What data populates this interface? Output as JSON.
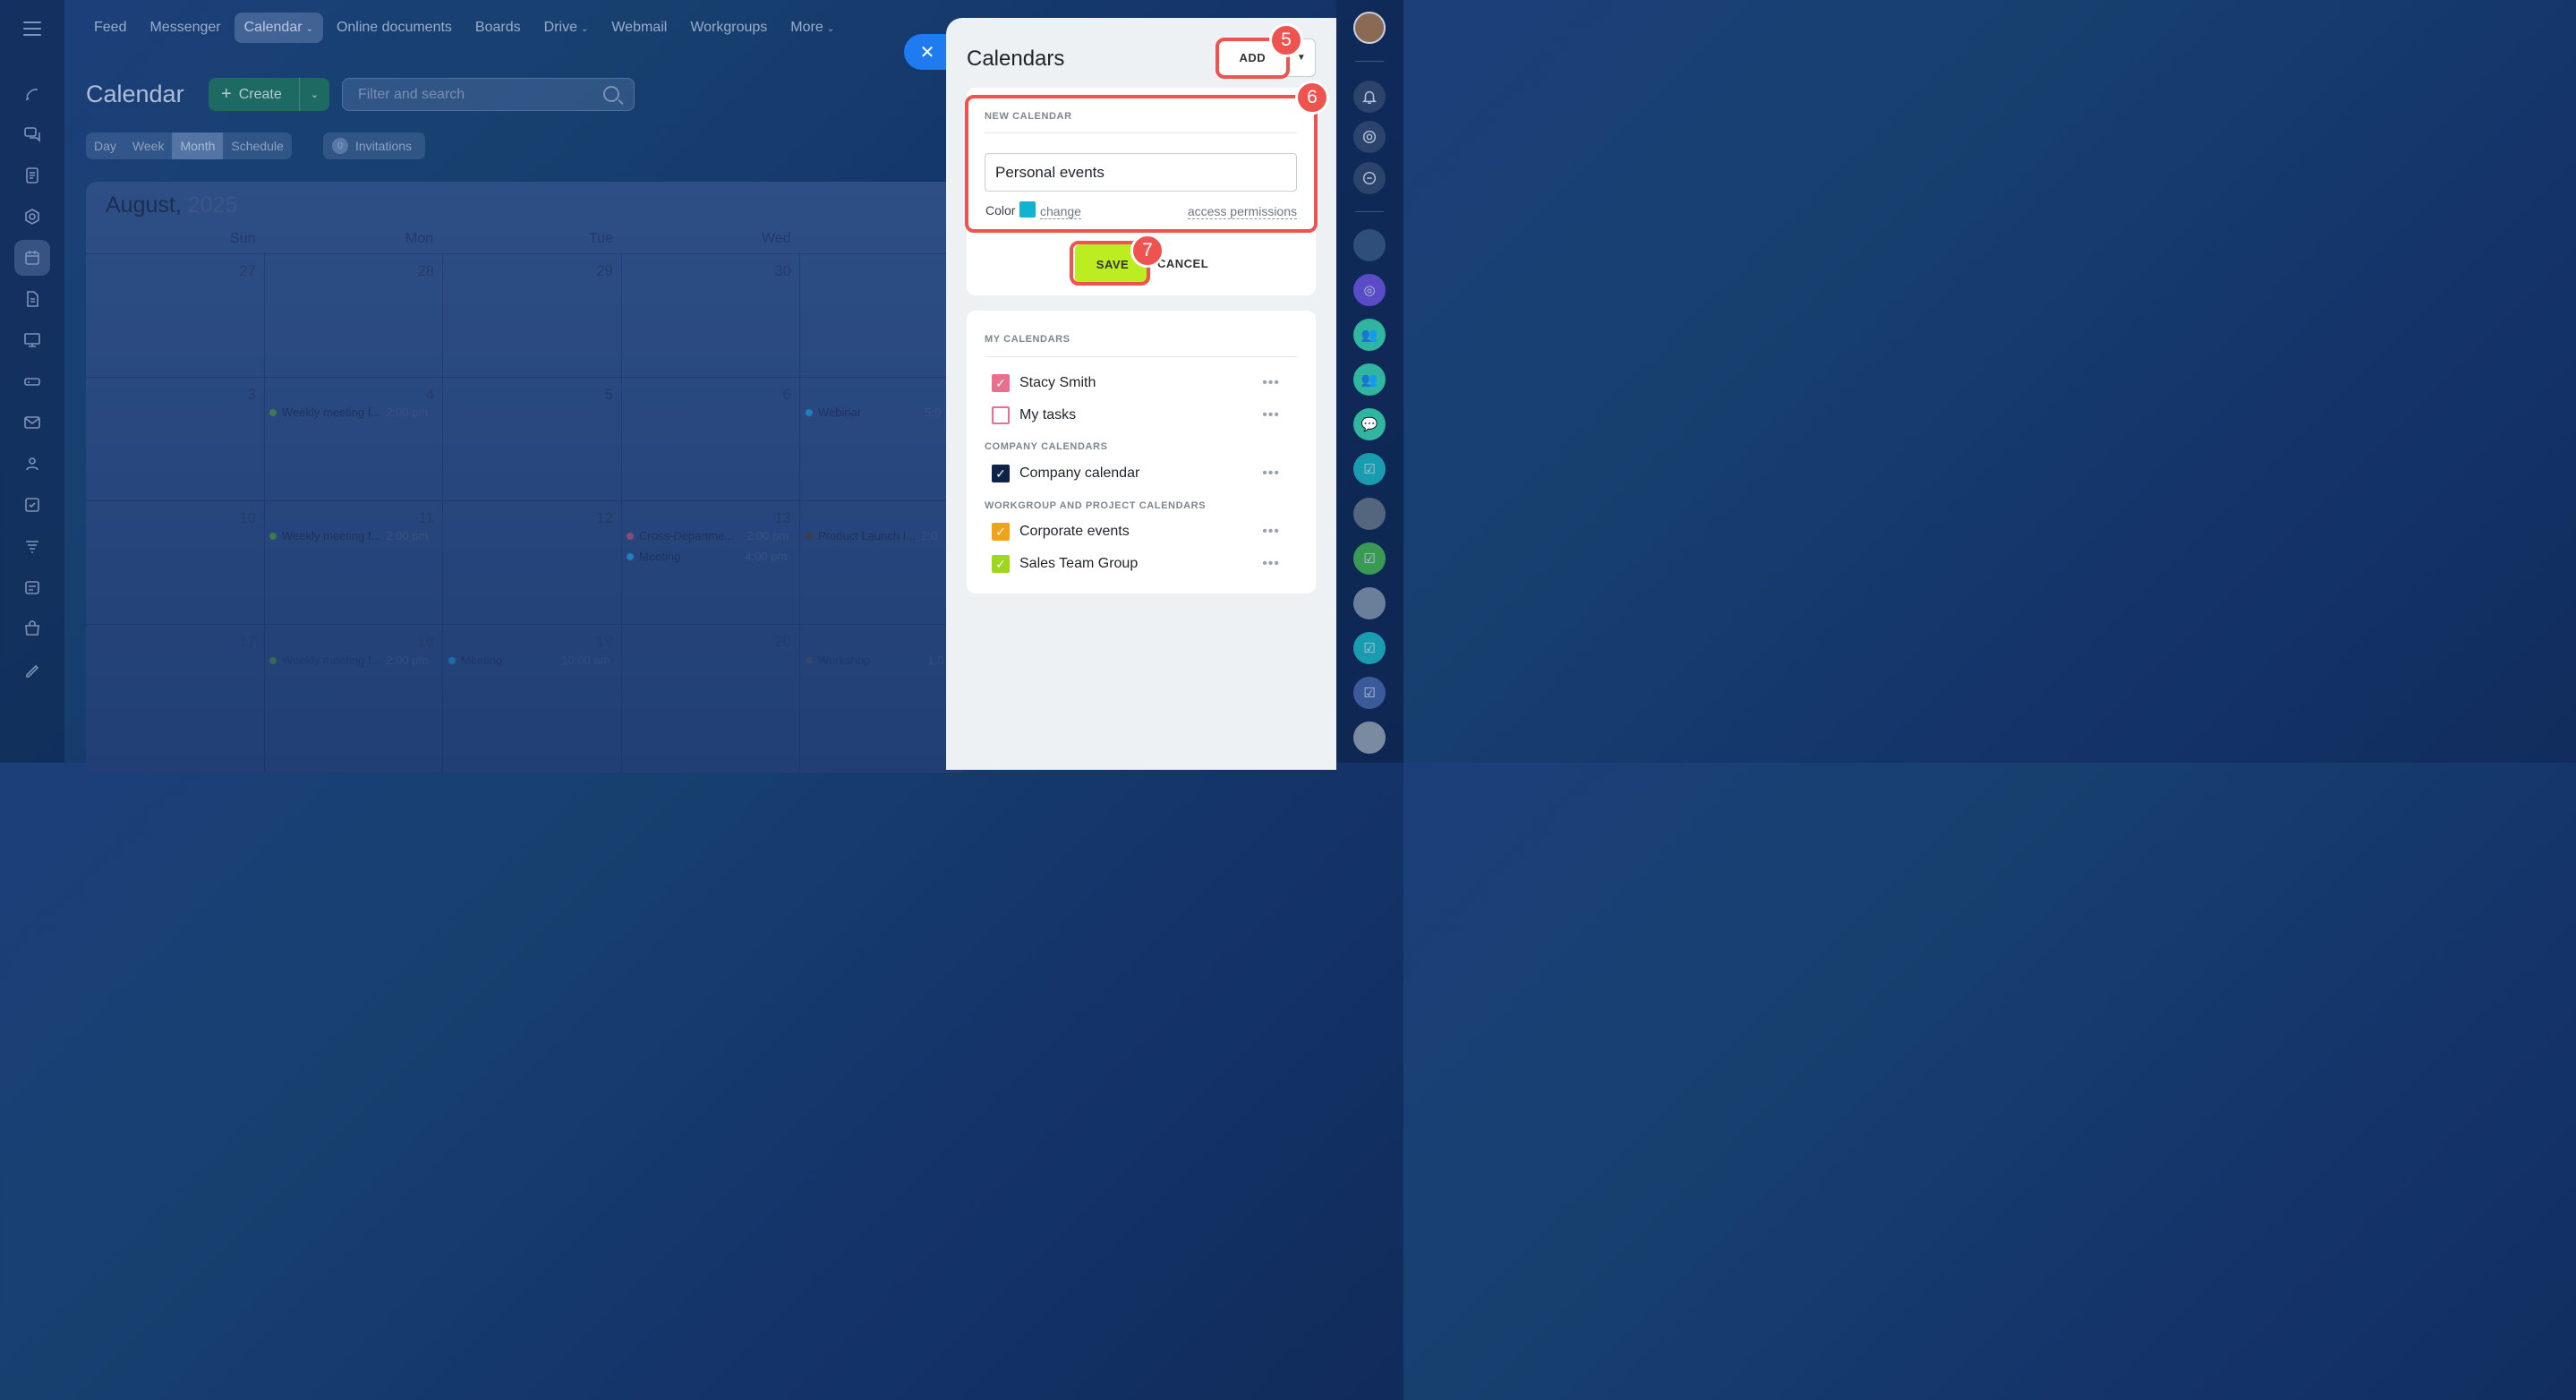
{
  "topnav": {
    "items": [
      {
        "label": "Feed"
      },
      {
        "label": "Messenger"
      },
      {
        "label": "Calendar",
        "active": true,
        "dropdown": true
      },
      {
        "label": "Online documents"
      },
      {
        "label": "Boards"
      },
      {
        "label": "Drive",
        "dropdown": true
      },
      {
        "label": "Webmail"
      },
      {
        "label": "Workgroups"
      },
      {
        "label": "More",
        "dropdown": true
      }
    ]
  },
  "calendar": {
    "title": "Calendar",
    "create_label": "Create",
    "search_placeholder": "Filter and search",
    "view_tabs": [
      "Day",
      "Week",
      "Month",
      "Schedule"
    ],
    "active_view": "Month",
    "invitations_count": "0",
    "invitations_label": "Invitations",
    "month": "August,",
    "year": "2025",
    "weekdays": [
      "Sun",
      "Mon",
      "Tue",
      "Wed"
    ],
    "rows": [
      [
        "27",
        "28",
        "29",
        "30"
      ],
      [
        "3",
        "4",
        "5",
        "6"
      ],
      [
        "10",
        "11",
        "12",
        "13"
      ],
      [
        "17",
        "18",
        "19",
        "20"
      ]
    ],
    "events": {
      "r1_mon": {
        "title": "Weekly meeting f...",
        "time": "2:00 pm",
        "color": "#3f7a4a"
      },
      "r1_wed": {
        "title": "Webinar",
        "time": "5:0",
        "color": "#1f7fbf"
      },
      "r2_mon": {
        "title": "Weekly meeting f...",
        "time": "2:00 pm",
        "color": "#3f7a4a"
      },
      "r2_tue1": {
        "title": "Cross-Departme...",
        "time": "2:00 pm",
        "color": "#8b4a7a"
      },
      "r2_tue2": {
        "title": "Meeting",
        "time": "4:00 pm",
        "color": "#1f7fbf"
      },
      "r2_wed": {
        "title": "Product Launch I...",
        "time": "2:0",
        "color": "#3b3f50"
      },
      "r3_mon": {
        "title": "Weekly meeting f...",
        "time": "2:00 pm",
        "color": "#3f7a4a"
      },
      "r3_mon2": {
        "title": "Meeting",
        "time": "10:00 am",
        "color": "#1f7fbf"
      },
      "r3_wed": {
        "title": "Workshop",
        "time": "1:0",
        "color": "#3b4a60"
      }
    }
  },
  "panel": {
    "title": "Calendars",
    "add_label": "ADD",
    "new_calendar_label": "NEW CALENDAR",
    "name_value": "Personal events",
    "color_label": "Color",
    "color_value": "#12b3d1",
    "change_label": "change",
    "access_label": "access permissions",
    "save_label": "SAVE",
    "cancel_label": "CANCEL",
    "my_calendars_label": "MY CALENDARS",
    "company_calendars_label": "COMPANY CALENDARS",
    "workgroup_calendars_label": "WORKGROUP AND PROJECT CALENDARS",
    "my_calendars": [
      {
        "name": "Stacy Smith",
        "checked": true,
        "color": "#e8708e"
      },
      {
        "name": "My tasks",
        "checked": false,
        "color": "#e8708e"
      }
    ],
    "company_calendars": [
      {
        "name": "Company calendar",
        "checked": true,
        "color": "#0e2347"
      }
    ],
    "workgroup_calendars": [
      {
        "name": "Corporate events",
        "checked": true,
        "color": "#f0a21a"
      },
      {
        "name": "Sales Team Group",
        "checked": true,
        "color": "#9fd61e"
      }
    ]
  },
  "callouts": {
    "add": "5",
    "new_calendar": "6",
    "save": "7"
  }
}
